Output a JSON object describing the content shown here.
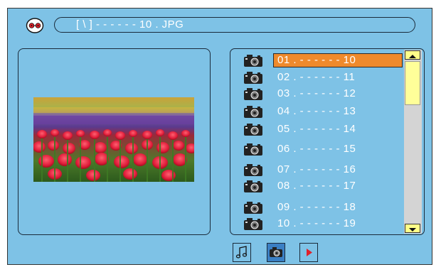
{
  "header": {
    "disc_icon": "disc-icon",
    "path_text": "[ \\ ] - - - - - - 10 . JPG"
  },
  "preview": {
    "image_description_icon": "tulip-photo"
  },
  "file_list": {
    "items": [
      {
        "label": "01 . - - - - - - 10",
        "icon": "camera-icon",
        "selected": true
      },
      {
        "label": "02 . - - - - - - 11",
        "icon": "camera-icon",
        "selected": false
      },
      {
        "label": "03 . - - - - - - 12",
        "icon": "camera-icon",
        "selected": false
      },
      {
        "label": "04 . - - - - - - 13",
        "icon": "camera-icon",
        "selected": false
      },
      {
        "label": "05 . - - - - - - 14",
        "icon": "camera-icon",
        "selected": false
      },
      {
        "label": "06 . - - - - - - 15",
        "icon": "camera-icon",
        "selected": false
      },
      {
        "label": "07 . - - - - - - 16",
        "icon": "camera-icon",
        "selected": false
      },
      {
        "label": "08 . - - - - - - 17",
        "icon": "camera-icon",
        "selected": false
      },
      {
        "label": "09 . - - - - - - 18",
        "icon": "camera-icon",
        "selected": false
      },
      {
        "label": "10 . - - - - - - 19",
        "icon": "camera-icon",
        "selected": false
      }
    ]
  },
  "mode_buttons": [
    {
      "icon": "music-note-icon",
      "active": false
    },
    {
      "icon": "camera-icon",
      "active": true
    },
    {
      "icon": "play-icon",
      "active": false
    }
  ],
  "colors": {
    "background": "#7ec2e6",
    "selected": "#ef8a2c",
    "scroll_button": "#ffff88"
  }
}
